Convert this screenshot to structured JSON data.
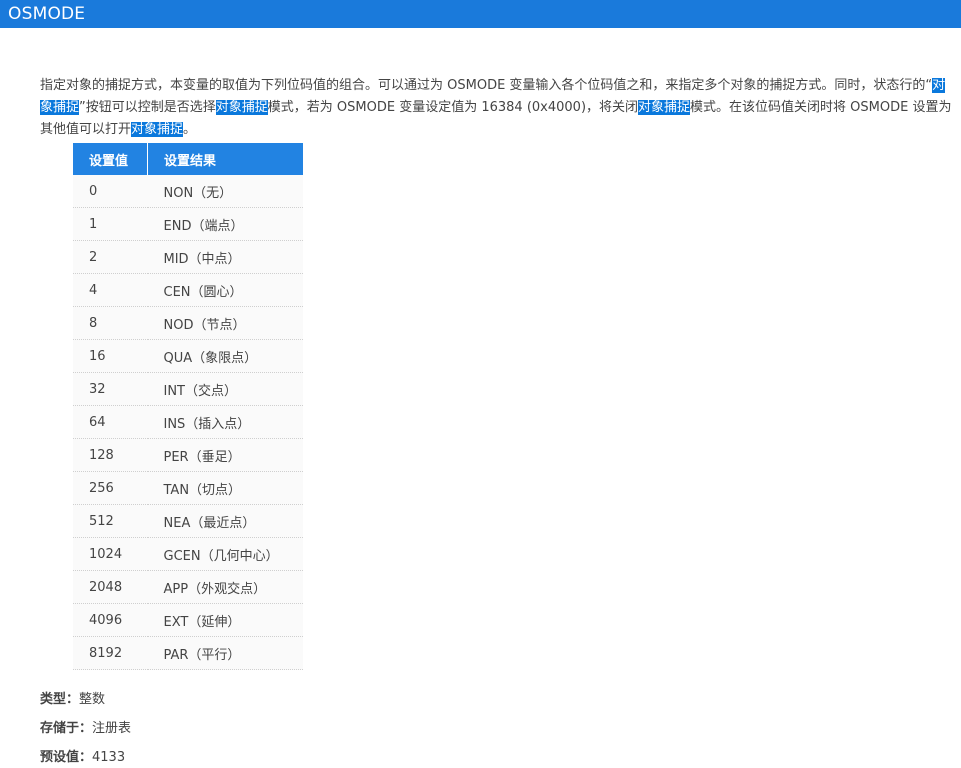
{
  "header": {
    "title": "OSMODE"
  },
  "description": {
    "parts": [
      {
        "text": "指定对象的捕捉方式，本变量的取值为下列位码值的组合。可以通过为 OSMODE 变量输入各个位码值之和，来指定多个对象的捕捉方式。同时，状态行的“",
        "highlight": false
      },
      {
        "text": "对象捕捉",
        "highlight": true
      },
      {
        "text": "”按钮可以控制是否选择",
        "highlight": false
      },
      {
        "text": "对象捕捉",
        "highlight": true
      },
      {
        "text": "模式，若为 OSMODE 变量设定值为 16384 (0x4000)，将关闭",
        "highlight": false
      },
      {
        "text": "对象捕捉",
        "highlight": true
      },
      {
        "text": "模式。在该位码值关闭时将 OSMODE 设置为其他值可以打开",
        "highlight": false
      },
      {
        "text": "对象捕捉",
        "highlight": true
      },
      {
        "text": "。",
        "highlight": false
      }
    ]
  },
  "table": {
    "headers": [
      "设置值",
      "设置结果"
    ],
    "rows": [
      [
        "0",
        "NON（无）"
      ],
      [
        "1",
        "END（端点）"
      ],
      [
        "2",
        "MID（中点）"
      ],
      [
        "4",
        "CEN（圆心）"
      ],
      [
        "8",
        "NOD（节点）"
      ],
      [
        "16",
        "QUA（象限点）"
      ],
      [
        "32",
        "INT（交点）"
      ],
      [
        "64",
        "INS（插入点）"
      ],
      [
        "128",
        "PER（垂足）"
      ],
      [
        "256",
        "TAN（切点）"
      ],
      [
        "512",
        "NEA（最近点）"
      ],
      [
        "1024",
        "GCEN（几何中心）"
      ],
      [
        "2048",
        "APP（外观交点）"
      ],
      [
        "4096",
        "EXT（延伸）"
      ],
      [
        "8192",
        "PAR（平行）"
      ]
    ]
  },
  "meta": {
    "type_label": "类型：",
    "type_value": "整数",
    "stored_label": "存储于：",
    "stored_value": "注册表",
    "default_label": "预设值：",
    "default_value": "4133"
  }
}
